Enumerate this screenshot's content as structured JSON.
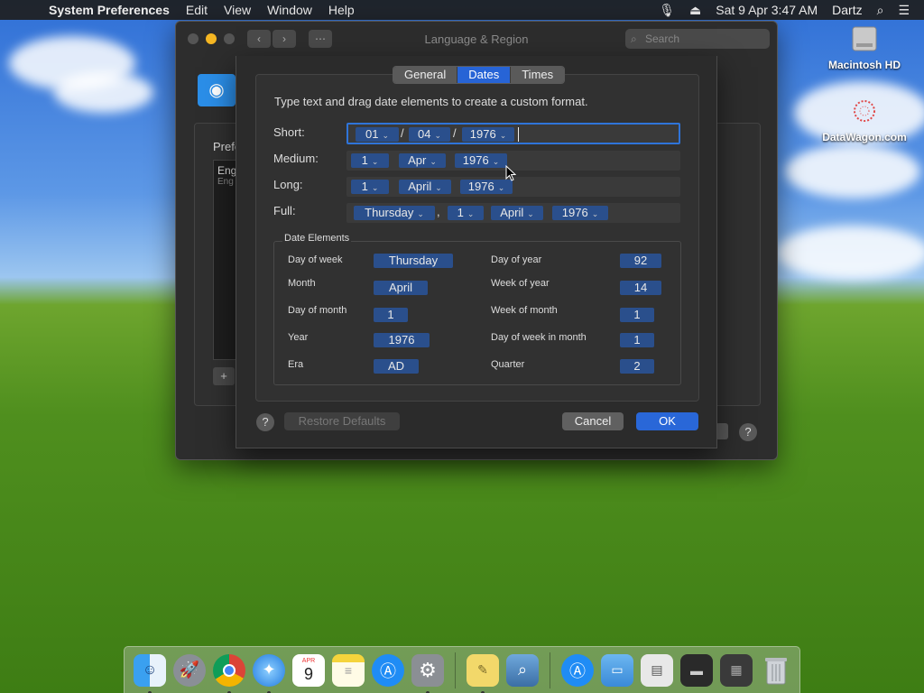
{
  "menubar": {
    "app_name": "System Preferences",
    "items": [
      "Edit",
      "View",
      "Window",
      "Help"
    ],
    "datetime": "Sat 9 Apr  3:47 AM",
    "user": "Dartz"
  },
  "desktop": {
    "icons": [
      {
        "label": "Macintosh HD"
      },
      {
        "label": "DataWagon.com"
      }
    ]
  },
  "back_window": {
    "title": "Language & Region",
    "search_placeholder": "Search",
    "pref_label": "Prefe",
    "list_item_primary": "Eng",
    "list_item_secondary": "Eng",
    "plus_label": "+",
    "help_label": "?"
  },
  "sheet": {
    "tabs": [
      {
        "label": "General",
        "active": false
      },
      {
        "label": "Dates",
        "active": true
      },
      {
        "label": "Times",
        "active": false
      }
    ],
    "instruction": "Type text and drag date elements to create a custom format.",
    "rows": {
      "short": {
        "label": "Short:",
        "tokens": [
          "01",
          "04",
          "1976"
        ],
        "seps": [
          "/",
          "/"
        ]
      },
      "medium": {
        "label": "Medium:",
        "tokens": [
          "1",
          "Apr",
          "1976"
        ]
      },
      "long": {
        "label": "Long:",
        "tokens": [
          "1",
          "April",
          "1976"
        ]
      },
      "full": {
        "label": "Full:",
        "tokens": [
          "Thursday",
          "1",
          "April",
          "1976"
        ],
        "seps": [
          ","
        ]
      }
    },
    "date_elements": {
      "title": "Date Elements",
      "left": [
        {
          "label": "Day of week",
          "value": "Thursday"
        },
        {
          "label": "Month",
          "value": "April"
        },
        {
          "label": "Day of month",
          "value": "1"
        },
        {
          "label": "Year",
          "value": "1976"
        },
        {
          "label": "Era",
          "value": "AD"
        }
      ],
      "right": [
        {
          "label": "Day of year",
          "value": "92"
        },
        {
          "label": "Week of year",
          "value": "14"
        },
        {
          "label": "Week of month",
          "value": "1"
        },
        {
          "label": "Day of week in month",
          "value": "1"
        },
        {
          "label": "Quarter",
          "value": "2"
        }
      ]
    },
    "help_label": "?",
    "restore_label": "Restore Defaults",
    "cancel_label": "Cancel",
    "ok_label": "OK"
  },
  "dock": {
    "calendar_month": "APR",
    "calendar_day": "9"
  },
  "colors": {
    "accent": "#2967d8",
    "token_bg": "#2a4f8c",
    "window_bg": "#2b2b2b"
  }
}
